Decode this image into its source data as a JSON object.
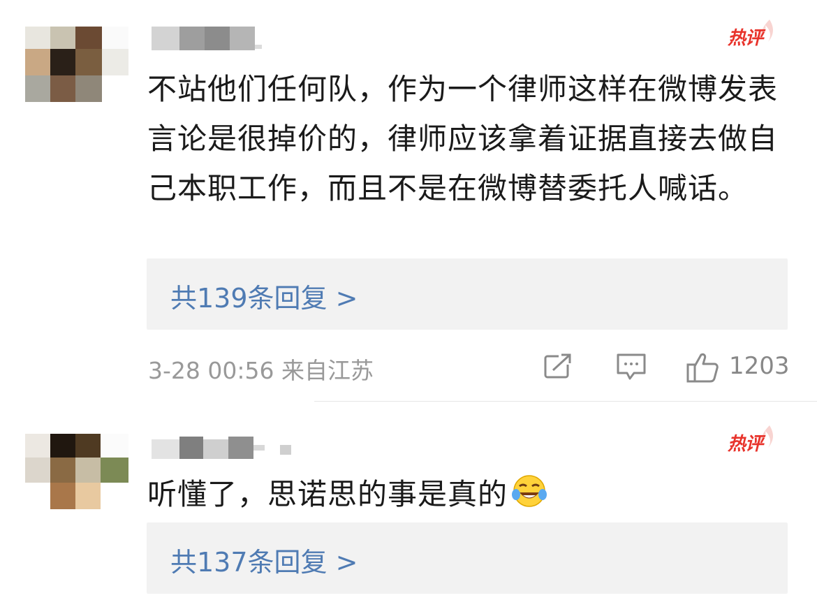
{
  "comments": [
    {
      "username": "",
      "badge": "热评",
      "text": "不站他们任何队，作为一个律师这样在微博发表言论是很掉价的，律师应该拿着证据直接去做自己本职工作，而且不是在微博替委托人喊话。",
      "replies": "共139条回复 >",
      "time": "3-28 00:56",
      "source": "来自江苏",
      "likes": "1203",
      "icons": [
        "share-icon",
        "comment-icon",
        "like-icon"
      ]
    },
    {
      "username": "",
      "badge": "热评",
      "text": "听懂了，思诺思的事是真的",
      "emoji": "laughing-crying-emoji",
      "replies": "共137条回复 >"
    }
  ],
  "colors": {
    "accent_link": "#4f7bb3",
    "hot_badge": "#e8332b",
    "meta": "#999999",
    "reply_bg": "#f2f2f2"
  }
}
